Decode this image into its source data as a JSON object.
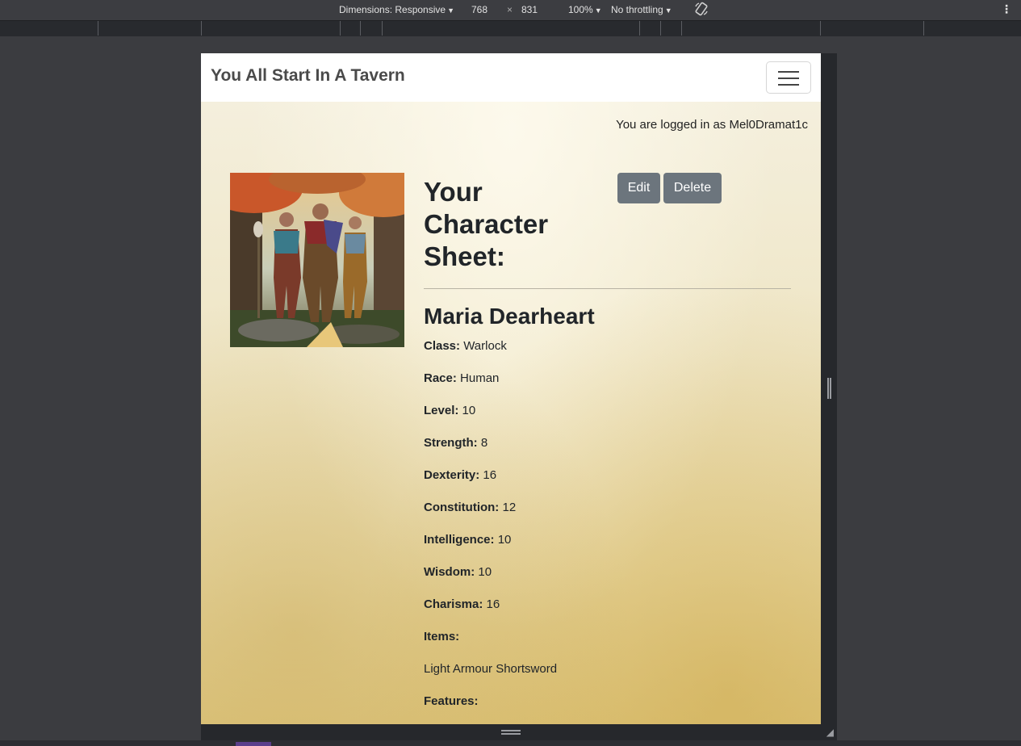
{
  "devtools": {
    "dimensions_label": "Dimensions: Responsive",
    "width": "768",
    "times": "×",
    "height": "831",
    "zoom": "100%",
    "throttling": "No throttling"
  },
  "site": {
    "brand": "You All Start In A Tavern",
    "logged_in_text": "You are logged in as Mel0Dramat1c"
  },
  "sheet": {
    "title": "Your Character Sheet:",
    "edit_label": "Edit",
    "delete_label": "Delete",
    "character_name": "Maria Dearheart",
    "stats": [
      {
        "label": "Class:",
        "value": "Warlock"
      },
      {
        "label": "Race:",
        "value": "Human"
      },
      {
        "label": "Level:",
        "value": "10"
      },
      {
        "label": "Strength:",
        "value": "8"
      },
      {
        "label": "Dexterity:",
        "value": "16"
      },
      {
        "label": "Constitution:",
        "value": "12"
      },
      {
        "label": "Intelligence:",
        "value": "10"
      },
      {
        "label": "Wisdom:",
        "value": "10"
      },
      {
        "label": "Charisma:",
        "value": "16"
      },
      {
        "label": "Items:",
        "value": ""
      },
      {
        "label": "",
        "value": "Light Armour Shortsword"
      },
      {
        "label": "Features:",
        "value": ""
      }
    ]
  }
}
